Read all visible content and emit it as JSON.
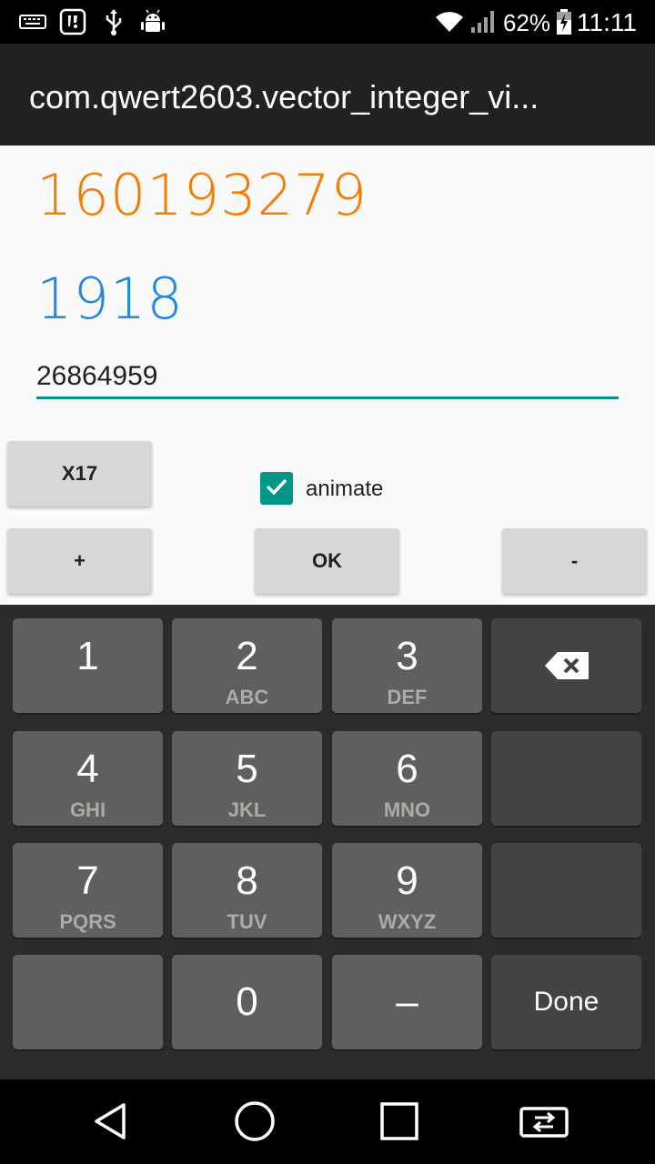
{
  "status_bar": {
    "battery_percent": "62%",
    "time": "11:11",
    "icons": [
      "keyboard-icon",
      "notification-badge-icon",
      "usb-icon",
      "android-debug-icon",
      "wifi-icon",
      "signal-icon",
      "battery-charging-icon"
    ]
  },
  "app_bar": {
    "title": "com.qwert2603.vector_integer_vi..."
  },
  "content": {
    "big_number": "160193279",
    "mid_number": "1918",
    "input_value": "26864959",
    "x17_label": "X17",
    "animate_label": "animate",
    "animate_checked": true,
    "plus_label": "+",
    "ok_label": "OK",
    "minus_label": "-"
  },
  "keyboard": {
    "keys": [
      {
        "num": "1",
        "sub": ""
      },
      {
        "num": "2",
        "sub": "ABC"
      },
      {
        "num": "3",
        "sub": "DEF"
      },
      {
        "num": "4",
        "sub": "GHI"
      },
      {
        "num": "5",
        "sub": "JKL"
      },
      {
        "num": "6",
        "sub": "MNO"
      },
      {
        "num": "7",
        "sub": "PQRS"
      },
      {
        "num": "8",
        "sub": "TUV"
      },
      {
        "num": "9",
        "sub": "WXYZ"
      },
      {
        "num": "0",
        "sub": ""
      }
    ],
    "dash_label": "–",
    "done_label": "Done",
    "backspace_icon": "backspace-icon"
  },
  "nav_bar": {
    "icons": [
      "back-icon",
      "home-icon",
      "recents-icon",
      "screen-switch-icon"
    ]
  },
  "colors": {
    "accent": "#009688",
    "big_number": "#f57c00",
    "mid_number": "#1e88e5"
  }
}
